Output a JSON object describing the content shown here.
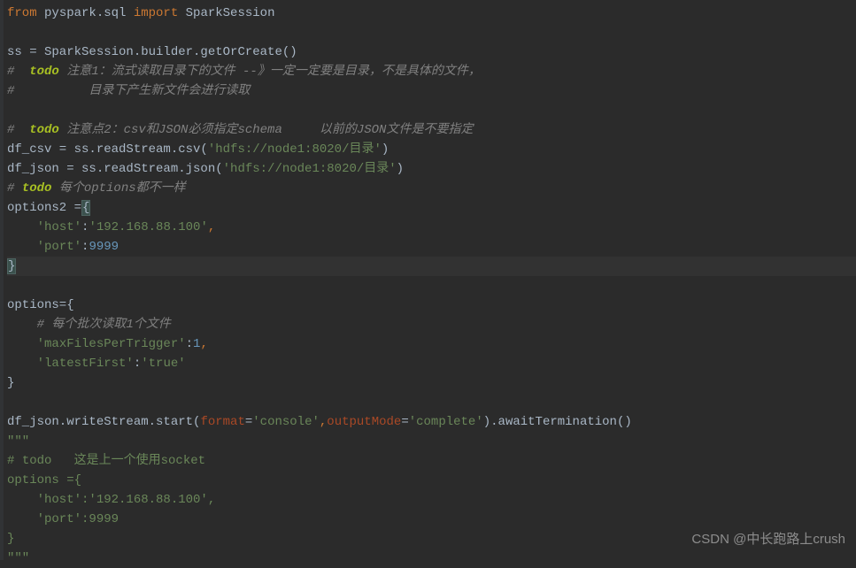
{
  "code": {
    "l1_from": "from",
    "l1_mod": " pyspark.sql ",
    "l1_import": "import",
    "l1_cls": " SparkSession",
    "l2": "",
    "l3": "ss = SparkSession.builder.getOrCreate()",
    "l4_hash": "#  ",
    "l4_todo": "todo",
    "l4_rest": " 注意1：流式读取目录下的文件 --》一定一定要是目录，不是具体的文件，",
    "l5_hash": "#",
    "l5_rest": "          目录下产生新文件会进行读取",
    "l6": "",
    "l7_hash": "#  ",
    "l7_todo": "todo",
    "l7_rest": " 注意点2：csv和JSON必须指定schema     以前的JSON文件是不要指定",
    "l8a": "df_csv = ss.readStream.csv(",
    "l8b": "'hdfs://node1:8020/目录'",
    "l8c": ")",
    "l9a": "df_json = ss.readStream.json(",
    "l9b": "'hdfs://node1:8020/目录'",
    "l9c": ")",
    "l10_hash": "# ",
    "l10_todo": "todo",
    "l10_rest": " 每个options都不一样",
    "l11a": "options2 =",
    "l11b": "{",
    "l12a": "    ",
    "l12b": "'host'",
    "l12c": ":",
    "l12d": "'192.168.88.100'",
    "l12e": ",",
    "l13a": "    ",
    "l13b": "'port'",
    "l13c": ":",
    "l13d": "9999",
    "l14": "}",
    "l15": "",
    "l16": "options={",
    "l17a": "    ",
    "l17b": "# 每个批次读取1个文件",
    "l18a": "    ",
    "l18b": "'maxFilesPerTrigger'",
    "l18c": ":",
    "l18d": "1",
    "l18e": ",",
    "l19a": "    ",
    "l19b": "'latestFirst'",
    "l19c": ":",
    "l19d": "'true'",
    "l20": "}",
    "l21": "",
    "l22a": "df_json.writeStream.start(",
    "l22b": "format",
    "l22c": "=",
    "l22d": "'console'",
    "l22e": ",",
    "l22f": "outputMode",
    "l22g": "=",
    "l22h": "'complete'",
    "l22i": ").awaitTermination()",
    "l23": "\"\"\"",
    "l24a": "# ",
    "l24b": "todo",
    "l24c": "   这是上一个使用socket",
    "l25": "options ={",
    "l26": "    'host':'192.168.88.100',",
    "l27": "    'port':9999",
    "l28": "}",
    "l29": "\"\"\""
  },
  "watermark": "CSDN @中长跑路上crush"
}
